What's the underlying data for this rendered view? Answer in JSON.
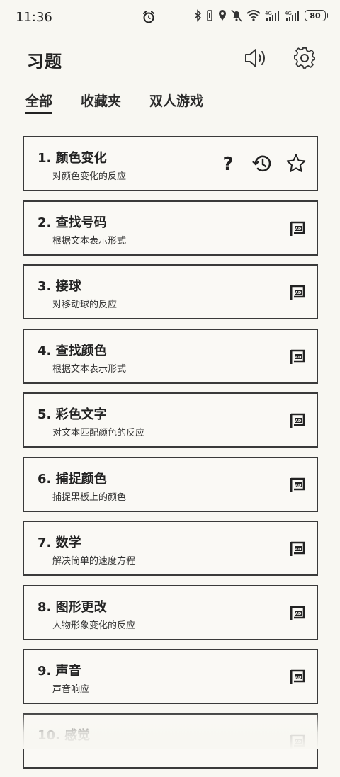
{
  "status_bar": {
    "time": "11:36",
    "battery": "80"
  },
  "header": {
    "title": "习题"
  },
  "tabs": [
    {
      "label": "全部",
      "active": true
    },
    {
      "label": "收藏夹",
      "active": false
    },
    {
      "label": "双人游戏",
      "active": false
    }
  ],
  "exercises": [
    {
      "title": "1. 颜色变化",
      "subtitle": "对颜色变化的反应"
    },
    {
      "title": "2. 查找号码",
      "subtitle": "根据文本表示形式"
    },
    {
      "title": "3. 接球",
      "subtitle": "对移动球的反应"
    },
    {
      "title": "4. 查找颜色",
      "subtitle": "根据文本表示形式"
    },
    {
      "title": "5. 彩色文字",
      "subtitle": "对文本匹配颜色的反应"
    },
    {
      "title": "6. 捕捉颜色",
      "subtitle": "捕捉黑板上的颜色"
    },
    {
      "title": "7. 数学",
      "subtitle": "解决简单的速度方程"
    },
    {
      "title": "8. 图形更改",
      "subtitle": "人物形象变化的反应"
    },
    {
      "title": "9. 声音",
      "subtitle": "声音响应"
    },
    {
      "title": "10. 感觉",
      "subtitle": ""
    }
  ],
  "icons": {
    "help": "help-icon",
    "history": "history-icon",
    "favorite": "star-icon",
    "ad": "ad-icon",
    "sound": "speaker-icon",
    "settings": "gear-icon"
  }
}
